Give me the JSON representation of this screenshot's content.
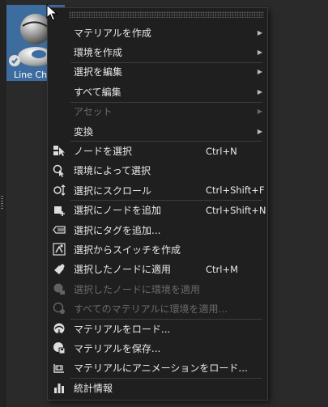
{
  "thumbnail": {
    "label": "Line Ch",
    "color": "#3d6c9e"
  },
  "menu": {
    "items": [
      {
        "label": "マテリアルを作成",
        "submenu": true
      },
      {
        "label": "環境を作成",
        "submenu": true
      },
      {
        "label": "選択を編集",
        "submenu": true
      },
      {
        "label": "すべて編集",
        "submenu": true
      },
      {
        "label": "アセット",
        "submenu": true,
        "disabled": true
      },
      {
        "label": "変換",
        "submenu": true
      },
      {
        "label": "ノードを選択",
        "shortcut": "Ctrl+N",
        "icon": "select-node-icon"
      },
      {
        "label": "環境によって選択",
        "icon": "select-by-environment-icon"
      },
      {
        "label": "選択にスクロール",
        "shortcut": "Ctrl+Shift+F",
        "icon": "scroll-to-selection-icon"
      },
      {
        "label": "選択にノードを追加",
        "shortcut": "Ctrl+Shift+N",
        "icon": "add-node-icon"
      },
      {
        "label": "選択にタグを追加...",
        "icon": "add-tag-icon"
      },
      {
        "label": "選択からスイッチを作成",
        "icon": "create-switch-icon"
      },
      {
        "label": "選択したノードに適用",
        "shortcut": "Ctrl+M",
        "icon": "apply-to-nodes-icon"
      },
      {
        "label": "選択したノードに環境を適用",
        "disabled": true,
        "icon": "apply-environment-icon"
      },
      {
        "label": "すべてのマテリアルに環境を適用...",
        "disabled": true,
        "icon": "apply-environment-all-icon"
      },
      {
        "label": "マテリアルをロード...",
        "icon": "load-material-icon"
      },
      {
        "label": "マテリアルを保存...",
        "icon": "save-material-icon"
      },
      {
        "label": "マテリアルにアニメーションをロード...",
        "icon": "load-animation-icon"
      },
      {
        "label": "統計情報",
        "icon": "statistics-icon"
      }
    ]
  }
}
